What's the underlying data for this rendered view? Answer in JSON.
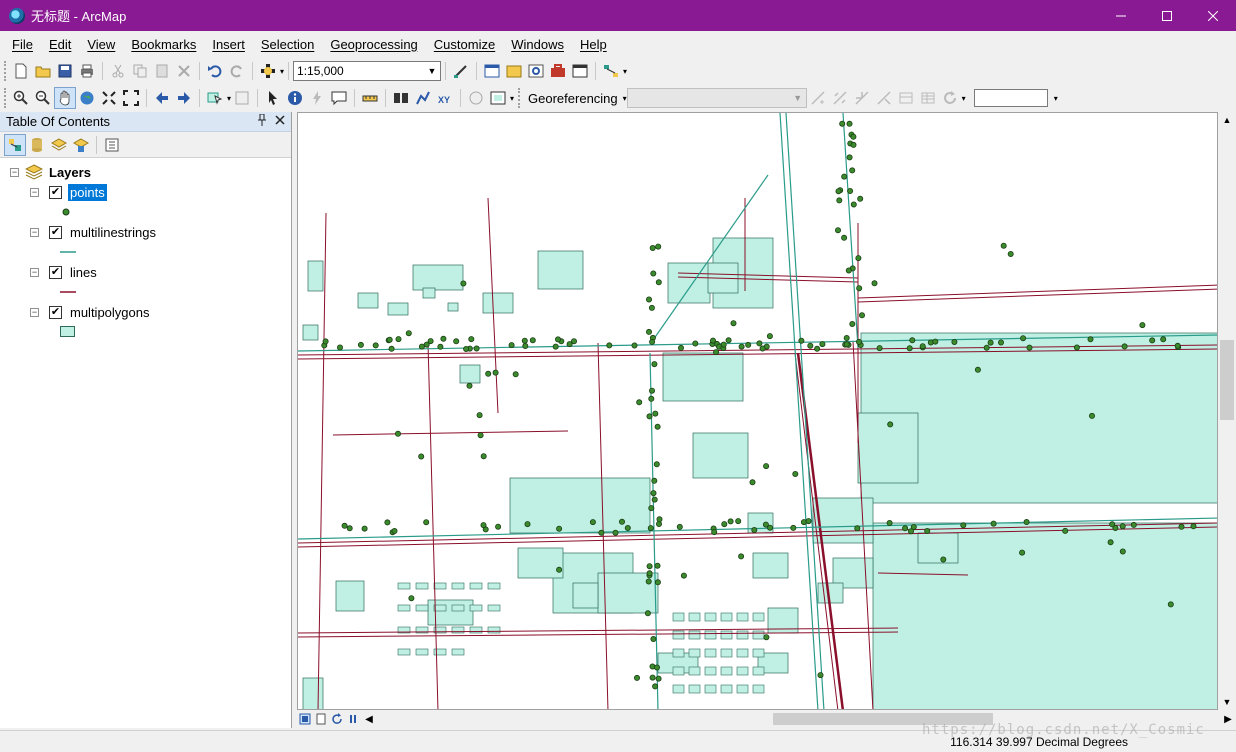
{
  "window": {
    "title": "无标题 - ArcMap",
    "controls": [
      "minimize",
      "maximize",
      "close"
    ]
  },
  "menu": [
    "File",
    "Edit",
    "View",
    "Bookmarks",
    "Insert",
    "Selection",
    "Geoprocessing",
    "Customize",
    "Windows",
    "Help"
  ],
  "toolbar_standard": {
    "scale_value": "1:15,000",
    "icons": [
      "new-document-icon",
      "open-icon",
      "save-icon",
      "print-icon",
      "cut-icon",
      "copy-icon",
      "paste-icon",
      "delete-icon",
      "undo-icon",
      "redo-icon",
      "add-data-icon",
      "editor-icon",
      "table-of-contents-icon",
      "catalog-icon",
      "search-window-icon",
      "arctoolbox-icon",
      "python-icon",
      "model-builder-icon"
    ]
  },
  "toolbar_tools": {
    "icons": [
      "zoom-in-icon",
      "zoom-out-icon",
      "pan-icon",
      "full-extent-icon",
      "fixed-zoom-in-icon",
      "fixed-zoom-out-icon",
      "back-icon",
      "forward-icon",
      "select-features-icon",
      "clear-selection-icon",
      "select-elements-icon",
      "identify-icon",
      "hyperlink-icon",
      "html-popup-icon",
      "measure-icon",
      "find-icon",
      "find-route-icon",
      "go-to-xy-icon",
      "time-slider-icon",
      "create-viewer-icon"
    ]
  },
  "georeferencing": {
    "label": "Georeferencing",
    "icons": [
      "add-control-points-icon",
      "auto-adjust-icon",
      "fit-to-display-icon",
      "update-display-icon",
      "rectify-icon",
      "view-link-table-icon",
      "rotate-icon"
    ]
  },
  "toc": {
    "title": "Table Of Contents",
    "tools": [
      "list-by-drawing-order-icon",
      "list-by-source-icon",
      "list-by-visibility-icon",
      "list-by-selection-icon",
      "options-icon"
    ],
    "root_label": "Layers",
    "layers": [
      {
        "name": "points",
        "checked": true,
        "selected": true,
        "legend": "point",
        "color": "#3c8a2e"
      },
      {
        "name": "multilinestrings",
        "checked": true,
        "selected": false,
        "legend": "line",
        "color": "#2a9b8a"
      },
      {
        "name": "lines",
        "checked": true,
        "selected": false,
        "legend": "line",
        "color": "#8a0f2a"
      },
      {
        "name": "multipolygons",
        "checked": true,
        "selected": false,
        "legend": "polygon",
        "color": "#bff0e3"
      }
    ]
  },
  "map": {
    "colors": {
      "polygon_fill": "#bff0e3",
      "polygon_stroke": "#2f6b5a",
      "line": "#8a0f2a",
      "multiline": "#2a9b8a",
      "point_fill": "#3c8a2e",
      "point_stroke": "#1a3f14"
    }
  },
  "status": {
    "coordinates": "116.314  39.997 Decimal Degrees"
  },
  "watermark": "https://blog.csdn.net/X_Cosmic"
}
